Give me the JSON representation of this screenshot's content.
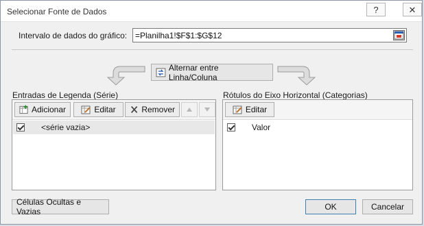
{
  "window": {
    "title": "Selecionar Fonte de Dados",
    "help_label": "?",
    "close_label": "✕"
  },
  "range": {
    "label": "Intervalo de dados do gráfico:",
    "value": "=Planilha1!$F$1:$G$12"
  },
  "switch_button": {
    "label": "Alternar entre Linha/Coluna"
  },
  "legend": {
    "title": "Entradas de Legenda (Série)",
    "add_label": "Adicionar",
    "edit_label": "Editar",
    "remove_label": "Remover",
    "items": [
      {
        "label": "<série vazia>",
        "checked": true
      }
    ]
  },
  "axis": {
    "title": "Rótulos do Eixo Horizontal (Categorias)",
    "edit_label": "Editar",
    "items": [
      {
        "label": "Valor",
        "checked": true
      }
    ]
  },
  "footer": {
    "hidden_cells_label": "Células Ocultas e Vazias",
    "ok_label": "OK",
    "cancel_label": "Cancelar"
  }
}
